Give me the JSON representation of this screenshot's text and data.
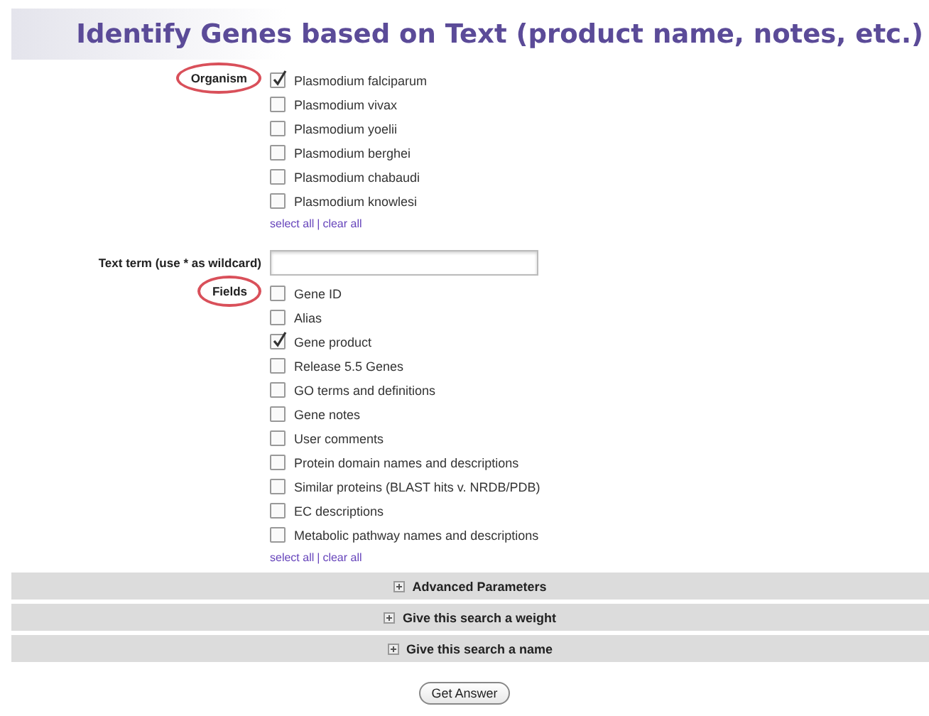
{
  "title": "Identify Genes based on Text (product name, notes, etc.)",
  "organism": {
    "label": "Organism",
    "options": [
      {
        "label": "Plasmodium falciparum",
        "checked": true
      },
      {
        "label": "Plasmodium vivax",
        "checked": false
      },
      {
        "label": "Plasmodium yoelii",
        "checked": false
      },
      {
        "label": "Plasmodium berghei",
        "checked": false
      },
      {
        "label": "Plasmodium chabaudi",
        "checked": false
      },
      {
        "label": "Plasmodium knowlesi",
        "checked": false
      }
    ],
    "select_all": "select all",
    "separator": "|",
    "clear_all": "clear all"
  },
  "text_term": {
    "label": "Text term (use * as wildcard)"
  },
  "fields": {
    "label": "Fields",
    "options": [
      {
        "label": "Gene ID",
        "checked": false
      },
      {
        "label": "Alias",
        "checked": false
      },
      {
        "label": "Gene product",
        "checked": true
      },
      {
        "label": "Release 5.5 Genes",
        "checked": false
      },
      {
        "label": "GO terms and definitions",
        "checked": false
      },
      {
        "label": "Gene notes",
        "checked": false
      },
      {
        "label": "User comments",
        "checked": false
      },
      {
        "label": "Protein domain names and descriptions",
        "checked": false
      },
      {
        "label": "Similar proteins (BLAST hits v. NRDB/PDB)",
        "checked": false
      },
      {
        "label": "EC descriptions",
        "checked": false
      },
      {
        "label": "Metabolic pathway names and descriptions",
        "checked": false
      }
    ],
    "select_all": "select all",
    "separator": "|",
    "clear_all": "clear all"
  },
  "sections": [
    {
      "label": "Advanced Parameters",
      "expanded": false
    },
    {
      "label": "Give this search a weight",
      "expanded": false
    },
    {
      "label": "Give this search a name",
      "expanded": false
    }
  ],
  "submit": "Get Answer"
}
